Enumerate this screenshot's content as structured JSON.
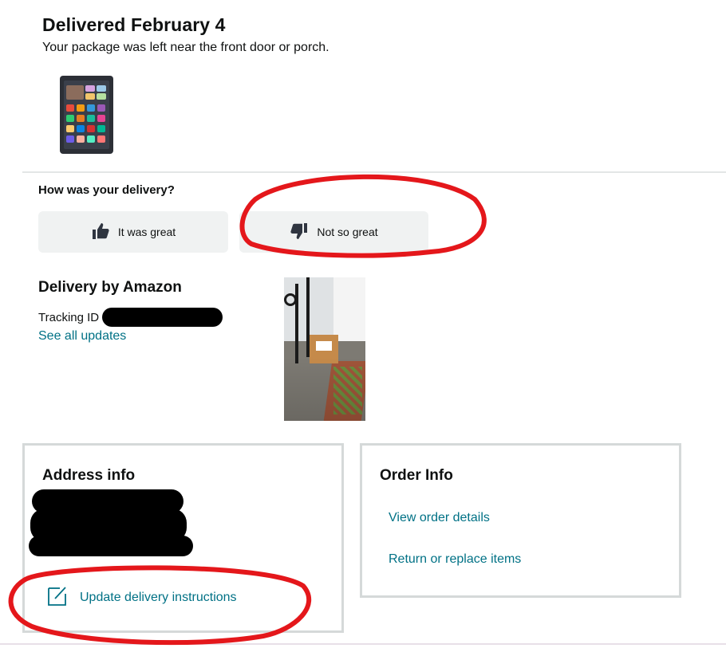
{
  "delivery": {
    "title": "Delivered February 4",
    "subtitle": "Your package was left near the front door or porch."
  },
  "feedback": {
    "question": "How was your delivery?",
    "positive_label": "It was great",
    "negative_label": "Not so great"
  },
  "carrier": {
    "heading": "Delivery by Amazon",
    "tracking_label": "Tracking ID",
    "see_updates_label": "See all updates"
  },
  "address_card": {
    "heading": "Address info",
    "update_label": "Update delivery instructions"
  },
  "order_card": {
    "heading": "Order Info",
    "view_order_label": "View order details",
    "return_label": "Return or replace items"
  },
  "colors": {
    "link": "#007185",
    "button_bg": "#f0f2f2",
    "card_border": "#d5d9d9",
    "annotation_red": "#e4171b"
  },
  "icons": [
    "thumbs-up-icon",
    "thumbs-down-icon",
    "edit-note-icon"
  ]
}
